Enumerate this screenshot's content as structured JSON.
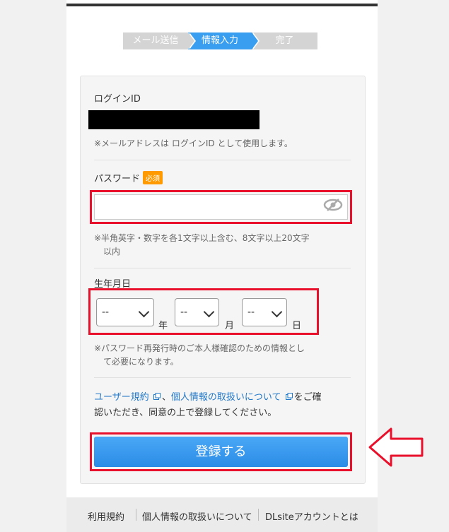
{
  "stepper": {
    "steps": [
      {
        "label": "メール送信"
      },
      {
        "label": "情報入力"
      },
      {
        "label": "完了"
      }
    ]
  },
  "form": {
    "login_id_label": "ログインID",
    "login_id_note": "※メールアドレスは ログインID として使用します。",
    "password_label": "パスワード",
    "required_badge": "必須",
    "password_value": "",
    "password_note_line1": "※半角英字・数字を各1文字以上含む、8文字以上20文字",
    "password_note_line2": "以内",
    "dob_label": "生年月日",
    "year_value": "--",
    "year_unit": "年",
    "month_value": "--",
    "month_unit": "月",
    "day_value": "--",
    "day_unit": "日",
    "dob_note_line1": "※パスワード再発行時のご本人様確認のための情報とし",
    "dob_note_line2": "て必要になります。",
    "terms_link": "ユーザー規約",
    "terms_sep": "、",
    "privacy_link": "個人情報の取扱いについて",
    "terms_text_1": "をご確",
    "terms_text_2": "認いただき、同意の上で登録してください。",
    "submit_label": "登録する"
  },
  "footer": {
    "links": [
      {
        "label": "利用規約"
      },
      {
        "label": "個人情報の取扱いについて"
      },
      {
        "label": "DLsiteアカウントとは"
      }
    ]
  },
  "colors": {
    "accent_blue": "#3a9ef0",
    "highlight_red": "#e8102a",
    "badge_orange": "#ff9a00",
    "link_blue": "#2378c8"
  },
  "icons": {
    "password_toggle": "eye-slash-icon",
    "external_link": "external-link-icon",
    "pointer": "arrow-left-icon"
  }
}
